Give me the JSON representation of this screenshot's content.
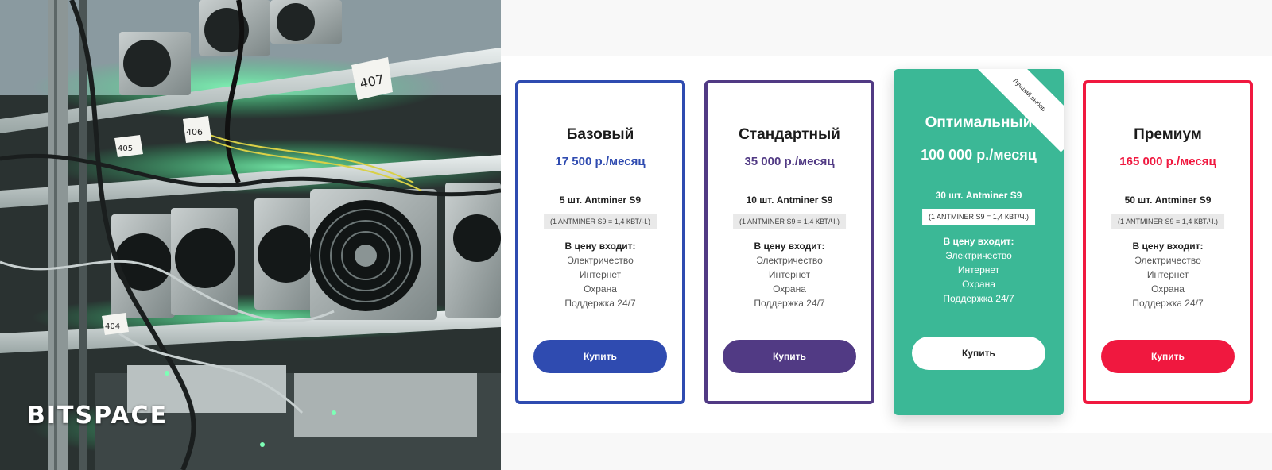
{
  "brand": {
    "logo_text": "BITSPACE"
  },
  "photo": {
    "rack_tags": [
      "407",
      "406",
      "405",
      "404"
    ]
  },
  "colors": {
    "basic": "#2f4bb0",
    "standard": "#513a84",
    "optimal": "#3bb896",
    "premium": "#f0183f"
  },
  "plans": [
    {
      "name": "Базовый",
      "price": "17 500 р./месяц",
      "quantity": "5 шт. Antminer S9",
      "note": "(1 ANTMINER S9 = 1,4 КВТ/Ч.)",
      "included_title": "В цену входит:",
      "included": [
        "Электричество",
        "Интернет",
        "Охрана",
        "Поддержка 24/7"
      ],
      "button": "Купить"
    },
    {
      "name": "Стандартный",
      "price": "35 000 р./месяц",
      "quantity": "10 шт. Antminer S9",
      "note": "(1 ANTMINER S9 = 1,4 КВТ/Ч.)",
      "included_title": "В цену входит:",
      "included": [
        "Электричество",
        "Интернет",
        "Охрана",
        "Поддержка 24/7"
      ],
      "button": "Купить"
    },
    {
      "name": "Оптимальный",
      "price": "100 000 р./месяц",
      "quantity": "30 шт. Antminer S9",
      "note": "(1 ANTMINER S9 = 1,4 КВТ/Ч.)",
      "included_title": "В цену входит:",
      "included": [
        "Электричество",
        "Интернет",
        "Охрана",
        "Поддержка 24/7"
      ],
      "button": "Купить",
      "badge": "Лучший выбор"
    },
    {
      "name": "Премиум",
      "price": "165 000 р./месяц",
      "quantity": "50 шт. Antminer S9",
      "note": "(1 ANTMINER S9 = 1,4 КВТ/Ч.)",
      "included_title": "В цену входит:",
      "included": [
        "Электричество",
        "Интернет",
        "Охрана",
        "Поддержка 24/7"
      ],
      "button": "Купить"
    }
  ]
}
